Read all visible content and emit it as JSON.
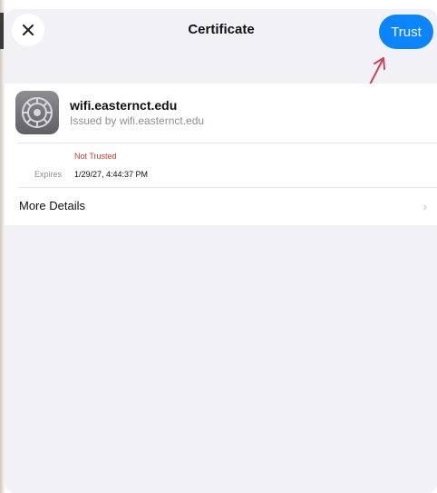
{
  "nav": {
    "title": "Certificate",
    "trust_label": "Trust"
  },
  "certificate": {
    "name": "wifi.easternct.edu",
    "issuer": "Issued by wifi.easternct.edu",
    "status": "Not Trusted",
    "expires_label": "Expires",
    "expires_value": "1/29/27, 4:44:37 PM"
  },
  "more_details": {
    "label": "More Details"
  },
  "icons": {
    "close": "close-icon",
    "certificate": "certificate-settings-icon",
    "chevron": "chevron-right-icon",
    "arrow": "annotation-arrow"
  },
  "colors": {
    "accent": "#0a84ff",
    "status_red": "#d13b2f",
    "background": "#f2f2f6",
    "annotation": "#d0405a"
  }
}
